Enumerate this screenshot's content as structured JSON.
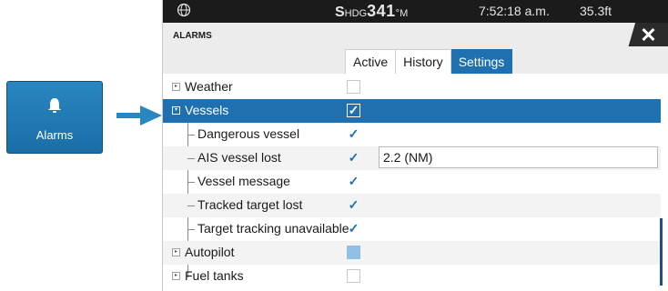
{
  "tile": {
    "label": "Alarms",
    "icon": "bell-icon"
  },
  "statusbar": {
    "globe_icon": "globe-icon",
    "heading_prefix": "S",
    "heading_label": "HDG",
    "heading_value": "341",
    "heading_unit": "°M",
    "time": "7:52:18 a.m.",
    "depth": "35.3ft"
  },
  "window": {
    "title": "ALARMS",
    "close_label": "✕"
  },
  "tabs": [
    {
      "label": "Active",
      "active": false
    },
    {
      "label": "History",
      "active": false
    },
    {
      "label": "Settings",
      "active": true
    }
  ],
  "rows": [
    {
      "label": "Weather",
      "level": 0,
      "expander": "▸",
      "checkbox": "unchecked"
    },
    {
      "label": "Vessels",
      "level": 0,
      "expander": "▾",
      "checkbox": "checked",
      "selected": true
    },
    {
      "label": "Dangerous vessel",
      "level": 1,
      "checkbox": "checked"
    },
    {
      "label": "AIS vessel lost",
      "level": 1,
      "checkbox": "checked",
      "value": "2.2 (NM)"
    },
    {
      "label": "Vessel message",
      "level": 1,
      "checkbox": "checked"
    },
    {
      "label": "Tracked target lost",
      "level": 1,
      "checkbox": "checked"
    },
    {
      "label": "Target tracking unavailable",
      "level": 1,
      "checkbox": "checked"
    },
    {
      "label": "Autopilot",
      "level": 0,
      "expander": "▸",
      "checkbox": "partial"
    },
    {
      "label": "Fuel tanks",
      "level": 0,
      "expander": "▸",
      "checkbox": "unchecked"
    }
  ],
  "colors": {
    "accent": "#1e70b0",
    "statusbar": "#1b1b1b",
    "tile": "#2a86c0"
  }
}
